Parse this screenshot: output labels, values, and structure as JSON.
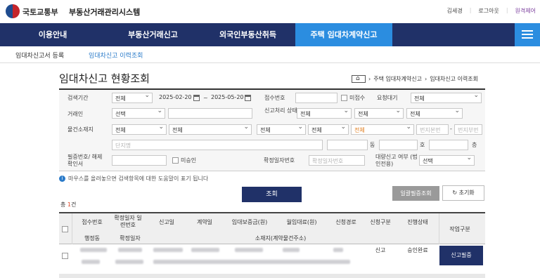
{
  "header": {
    "ministry": "국토교통부",
    "system_title": "부동산거래관리시스템",
    "user_name": "김세경",
    "logout": "로그아웃",
    "remote": "원격제어"
  },
  "gnb": {
    "items": [
      "이용안내",
      "부동산거래신고",
      "외국인부동산취득",
      "주택 임대차계약신고"
    ],
    "active_index": 3
  },
  "subnav": {
    "items": [
      "임대차신고서 등록",
      "임대차신고 이력조회"
    ],
    "active_index": 1
  },
  "page": {
    "title": "임대차신고 현황조회",
    "breadcrumb_home": "홈",
    "breadcrumb_1": "주택 임대차계약신고",
    "breadcrumb_2": "임대차신고 이력조회"
  },
  "form": {
    "period_label": "검색기간",
    "period_select": "전체",
    "date_from": "2025-02-20",
    "date_to": "2025-05-20",
    "receipt_no_label": "접수번호",
    "unreceived_label": "미접수",
    "request_wait_label": "요청대기",
    "request_wait_select": "전체",
    "party_label": "거래인",
    "party_select": "선택",
    "report_status_label": "신고처리 상태",
    "status_select_1": "전체",
    "status_select_2": "전체",
    "status_select_3": "전체",
    "location_label": "물건소재지",
    "loc_sido": "전체",
    "loc_sigungu": "전체",
    "loc_dong": "전체",
    "loc_ri": "전체",
    "loc_gubun": "전체",
    "bunji_main_ph": "번지본번",
    "bunji_sub_ph": "번지부번",
    "complex_ph": "단지명",
    "dong_suffix": "동",
    "ho_suffix": "호",
    "floor_suffix": "층",
    "cert_label": "필증번호/ 해제확인서",
    "unapproved_label": "미승인",
    "fixed_date_label": "확정일자번호",
    "fixed_date_ph": "확정일자번호",
    "proxy_label": "대량신고 여부 (법인전용)",
    "proxy_select": "선택"
  },
  "info_text": "마우스를 올려놓으면 검색항목에 대한 도움말이 표기 됩니다",
  "buttons": {
    "search": "조회",
    "bulk_approve": "일괄필증조회",
    "reset": "초기화"
  },
  "count": {
    "prefix": "총 ",
    "value": "1",
    "suffix": "건"
  },
  "table": {
    "headers_top": [
      "접수번호",
      "확정일자 일련번호",
      "신고일",
      "계약일",
      "임대보증금(원)",
      "월임대료(원)",
      "신청경로",
      "신청구분",
      "진행상태",
      "작업구분"
    ],
    "headers_bottom": [
      "행정동",
      "확정일자",
      "소재지(계약물건주소)"
    ],
    "row": {
      "apply_type": "신고",
      "status": "승인완료",
      "action": "신고필증"
    }
  },
  "colors": {
    "navy": "#203168",
    "accent_blue": "#2b8de0",
    "gray_button": "#9a9a9a"
  }
}
